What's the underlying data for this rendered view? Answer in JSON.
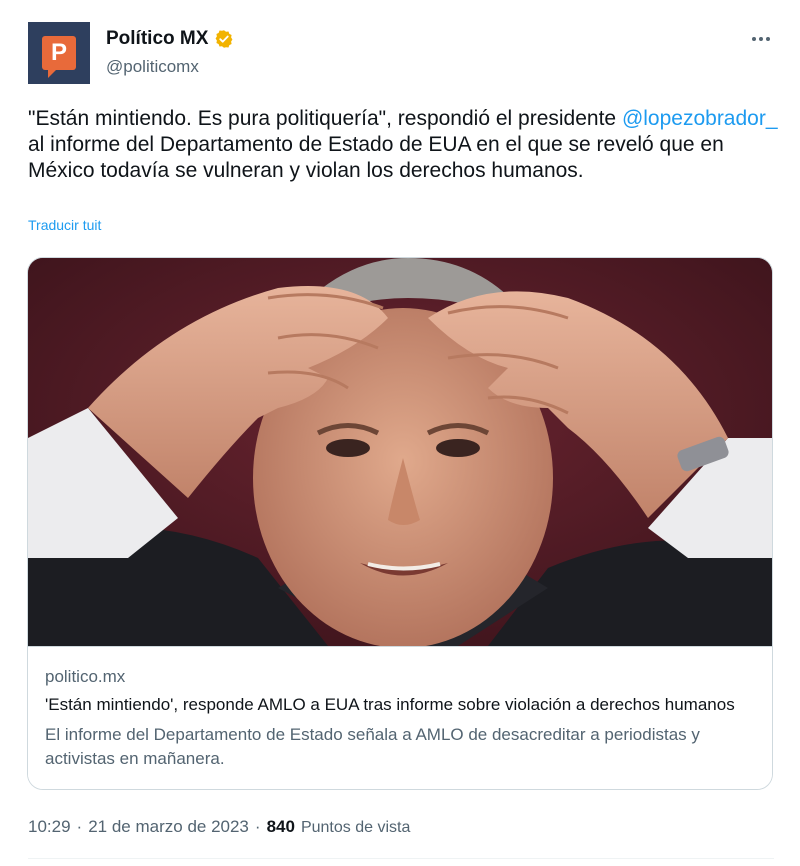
{
  "author": {
    "name": "Político MX",
    "handle": "@politicomx",
    "avatar_letter": "P",
    "avatar_bg": "#2e3f5e",
    "avatar_accent": "#e86a3a",
    "verified_icon": "verified-badge-icon",
    "verified_color": "#f2b300"
  },
  "more_icon": "more-horizontal-icon",
  "tweet": {
    "text_before": "\"Están mintiendo. Es pura politiquería\", respondió el presidente ",
    "mention": "@lopezobrador_",
    "text_after": " al informe del Departamento de Estado de EUA en el que se reveló que en México todavía se vulneran y violan los derechos humanos.",
    "translate_label": "Traducir tuit"
  },
  "card": {
    "domain": "politico.mx",
    "title": "'Están mintiendo', responde AMLO a EUA tras informe sobre violación a derechos humanos",
    "description": "El informe del Departamento de Estado señala a AMLO de desacreditar a periodistas y activistas en mañanera."
  },
  "meta": {
    "time": "10:29",
    "sep1": "·",
    "date": "21 de marzo de 2023",
    "sep2": "·",
    "views_count": "840",
    "views_label": "Puntos de vista"
  },
  "colors": {
    "link": "#1d9bf0",
    "secondary_text": "#536471",
    "border": "#cfd9de"
  }
}
